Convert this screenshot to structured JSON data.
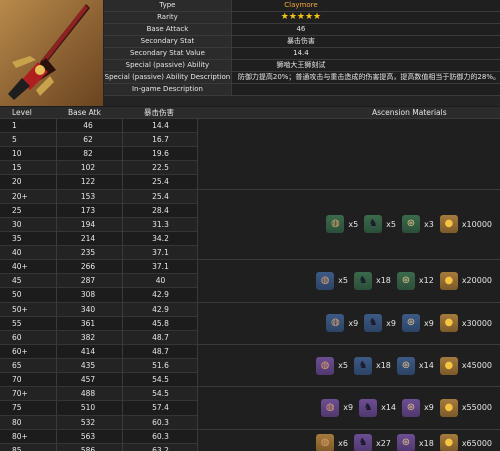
{
  "weapon": {
    "icon": "greatsword-image",
    "rows": [
      {
        "key": "Type",
        "value": "Claymore",
        "style": "orange"
      },
      {
        "key": "Rarity",
        "value": "★★★★★",
        "style": "stars"
      },
      {
        "key": "Base Attack",
        "value": "46",
        "style": "center"
      },
      {
        "key": "Secondary Stat",
        "value": "暴击伤害",
        "style": "center"
      },
      {
        "key": "Secondary Stat Value",
        "value": "14.4",
        "style": "center"
      },
      {
        "key": "Special (passive) Ability",
        "value": "狮啮大王狮刻试",
        "style": "center"
      },
      {
        "key": "Special (passive) Ability Description",
        "value": "防御力提高20%；普通攻击与重击造成的伤害提高，提高数值相当于防御力的28%。",
        "style": "left"
      },
      {
        "key": "In-game Description",
        "value": "",
        "style": "left"
      }
    ]
  },
  "table": {
    "headers": {
      "level": "Level",
      "base_atk": "Base Atk",
      "secondary": "暴击伤害",
      "materials": "Ascension Materials"
    },
    "rows": [
      {
        "level": "1",
        "atk": "46",
        "sec": "14.4"
      },
      {
        "level": "5",
        "atk": "62",
        "sec": "16.7"
      },
      {
        "level": "10",
        "atk": "82",
        "sec": "19.6"
      },
      {
        "level": "15",
        "atk": "102",
        "sec": "22.5"
      },
      {
        "level": "20",
        "atk": "122",
        "sec": "25.4"
      },
      {
        "level": "20+",
        "atk": "153",
        "sec": "25.4"
      },
      {
        "level": "25",
        "atk": "173",
        "sec": "28.4"
      },
      {
        "level": "30",
        "atk": "194",
        "sec": "31.3"
      },
      {
        "level": "35",
        "atk": "214",
        "sec": "34.2"
      },
      {
        "level": "40",
        "atk": "235",
        "sec": "37.1"
      },
      {
        "level": "40+",
        "atk": "266",
        "sec": "37.1"
      },
      {
        "level": "45",
        "atk": "287",
        "sec": "40"
      },
      {
        "level": "50",
        "atk": "308",
        "sec": "42.9"
      },
      {
        "level": "50+",
        "atk": "340",
        "sec": "42.9"
      },
      {
        "level": "55",
        "atk": "361",
        "sec": "45.8"
      },
      {
        "level": "60",
        "atk": "382",
        "sec": "48.7"
      },
      {
        "level": "60+",
        "atk": "414",
        "sec": "48.7"
      },
      {
        "level": "65",
        "atk": "435",
        "sec": "51.6"
      },
      {
        "level": "70",
        "atk": "457",
        "sec": "54.5"
      },
      {
        "level": "70+",
        "atk": "488",
        "sec": "54.5"
      },
      {
        "level": "75",
        "atk": "510",
        "sec": "57.4"
      },
      {
        "level": "80",
        "atk": "532",
        "sec": "60.3"
      },
      {
        "level": "80+",
        "atk": "563",
        "sec": "60.3"
      },
      {
        "level": "85",
        "atk": "586",
        "sec": "63.2"
      }
    ],
    "ascensions": [
      {
        "mats": [
          {
            "icon": "mask-fragment-icon",
            "quality": "q2",
            "count": "x5"
          },
          {
            "icon": "slime-icon",
            "quality": "q2",
            "count": "x5"
          },
          {
            "icon": "scroll-icon",
            "quality": "q2",
            "count": "x3"
          },
          {
            "icon": "mora-coin-icon",
            "quality": "q5",
            "count": "x10000"
          }
        ]
      },
      {
        "mats": [
          {
            "icon": "mask-fragment-icon",
            "quality": "q3",
            "count": "x5"
          },
          {
            "icon": "slime-icon",
            "quality": "q2",
            "count": "x18"
          },
          {
            "icon": "scroll-icon",
            "quality": "q2",
            "count": "x12"
          },
          {
            "icon": "mora-coin-icon",
            "quality": "q5",
            "count": "x20000"
          }
        ]
      },
      {
        "mats": [
          {
            "icon": "mask-fragment-icon",
            "quality": "q3",
            "count": "x9"
          },
          {
            "icon": "slime-icon",
            "quality": "q3",
            "count": "x9"
          },
          {
            "icon": "scroll-icon",
            "quality": "q3",
            "count": "x9"
          },
          {
            "icon": "mora-coin-icon",
            "quality": "q5",
            "count": "x30000"
          }
        ]
      },
      {
        "mats": [
          {
            "icon": "mask-fragment-icon",
            "quality": "q4",
            "count": "x5"
          },
          {
            "icon": "slime-icon",
            "quality": "q3",
            "count": "x18"
          },
          {
            "icon": "scroll-icon",
            "quality": "q3",
            "count": "x14"
          },
          {
            "icon": "mora-coin-icon",
            "quality": "q5",
            "count": "x45000"
          }
        ]
      },
      {
        "mats": [
          {
            "icon": "mask-fragment-icon",
            "quality": "q4",
            "count": "x9"
          },
          {
            "icon": "slime-icon",
            "quality": "q4",
            "count": "x14"
          },
          {
            "icon": "scroll-icon",
            "quality": "q4",
            "count": "x9"
          },
          {
            "icon": "mora-coin-icon",
            "quality": "q5",
            "count": "x55000"
          }
        ]
      },
      {
        "mats": [
          {
            "icon": "mask-fragment-icon",
            "quality": "q5",
            "count": "x6"
          },
          {
            "icon": "slime-icon",
            "quality": "q4",
            "count": "x27"
          },
          {
            "icon": "scroll-icon",
            "quality": "q4",
            "count": "x18"
          },
          {
            "icon": "mora-coin-icon",
            "quality": "q5",
            "count": "x65000"
          }
        ]
      }
    ]
  }
}
